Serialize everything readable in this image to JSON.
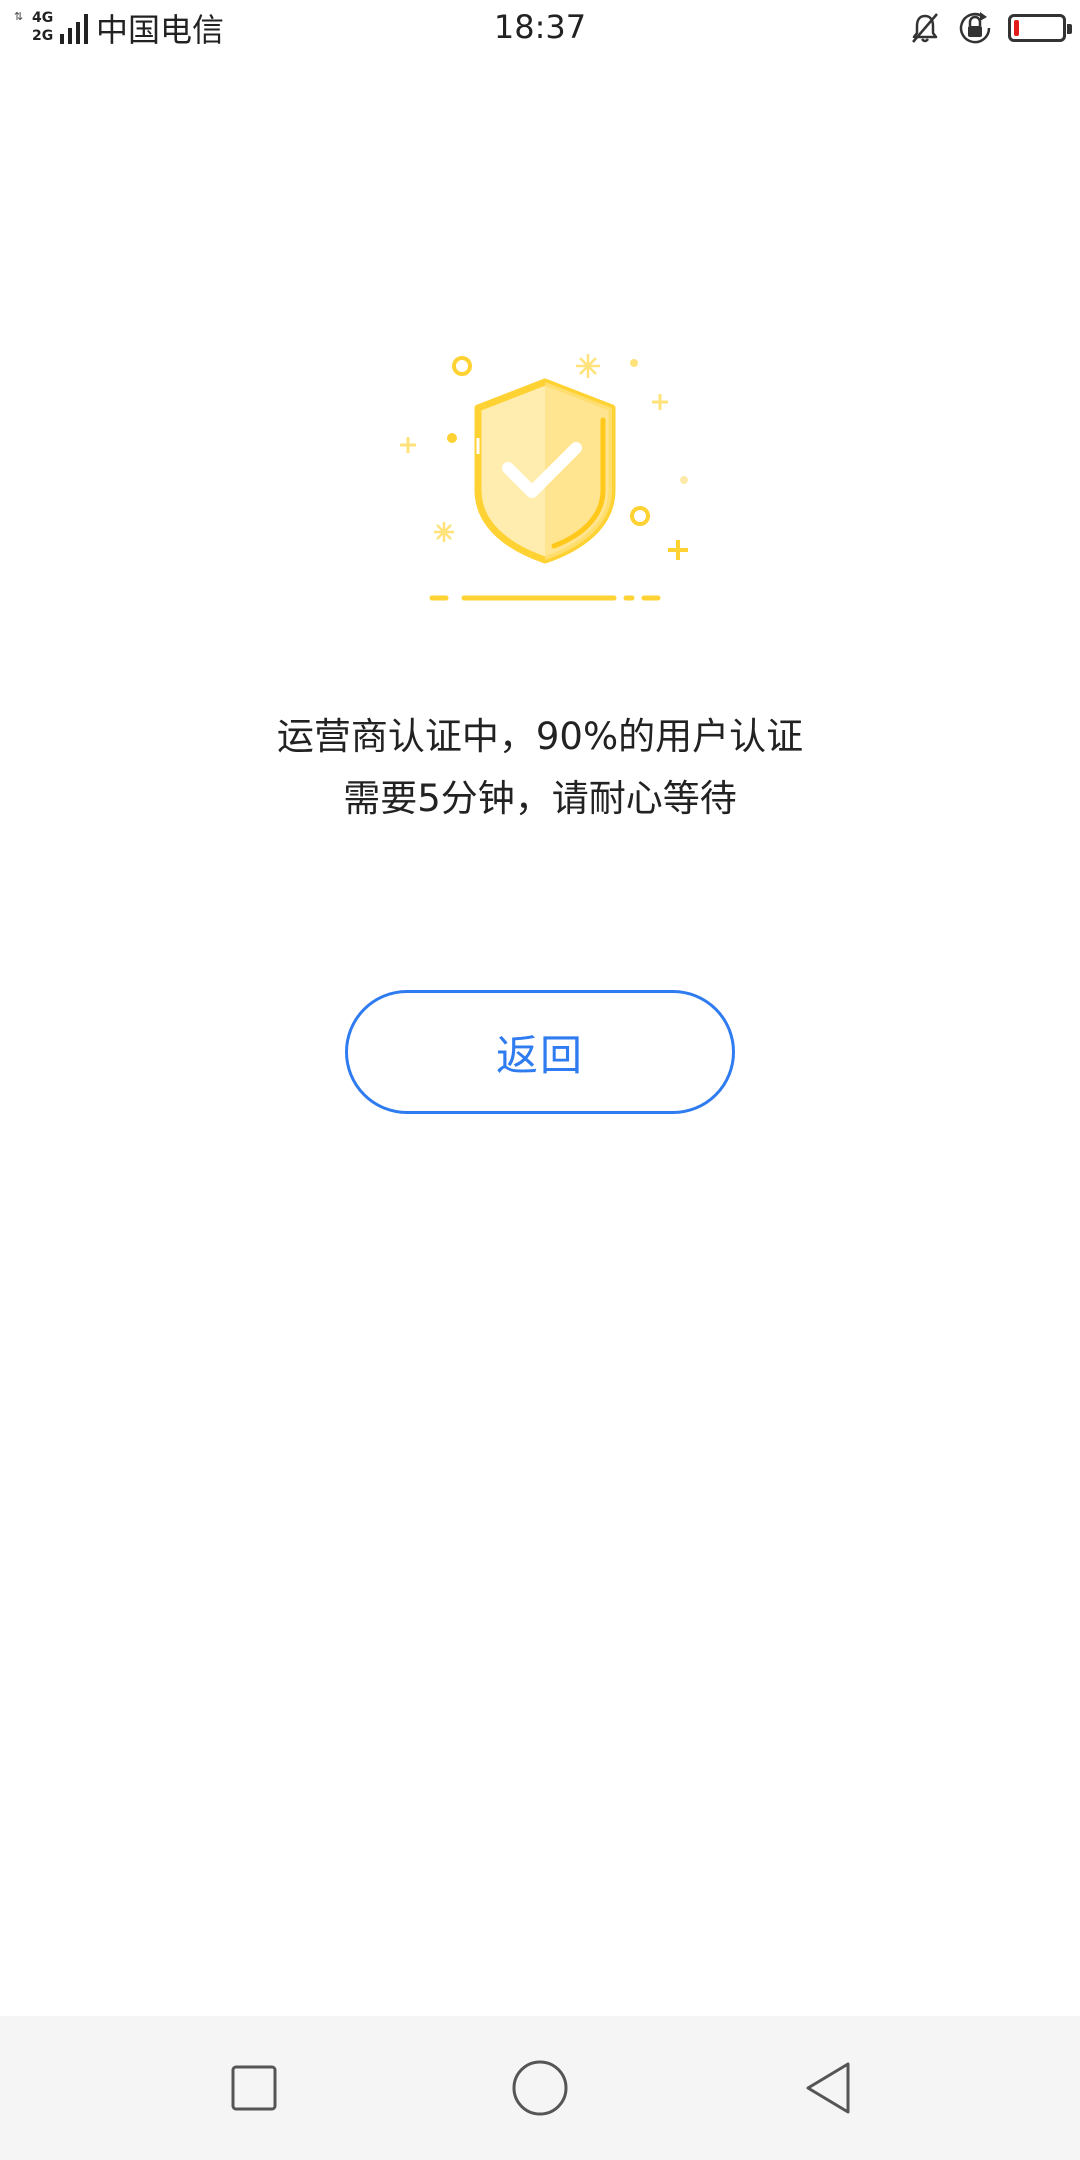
{
  "status_bar": {
    "network_top": "4G",
    "network_bottom": "2G",
    "carrier": "中国电信",
    "time": "18:37",
    "battery_level": 0.1
  },
  "colors": {
    "accent": "#2f7cf0",
    "shield_yellow": "#ffd233",
    "battery_low": "#e21b1b"
  },
  "illustration": {
    "icon": "shield-check-icon"
  },
  "message": {
    "line1": "运营商认证中，90%的用户认证",
    "line2": "需要5分钟，请耐心等待"
  },
  "back_button": {
    "label": "返回"
  },
  "nav": {
    "recent_icon": "square-icon",
    "home_icon": "circle-icon",
    "back_icon": "triangle-back-icon"
  }
}
